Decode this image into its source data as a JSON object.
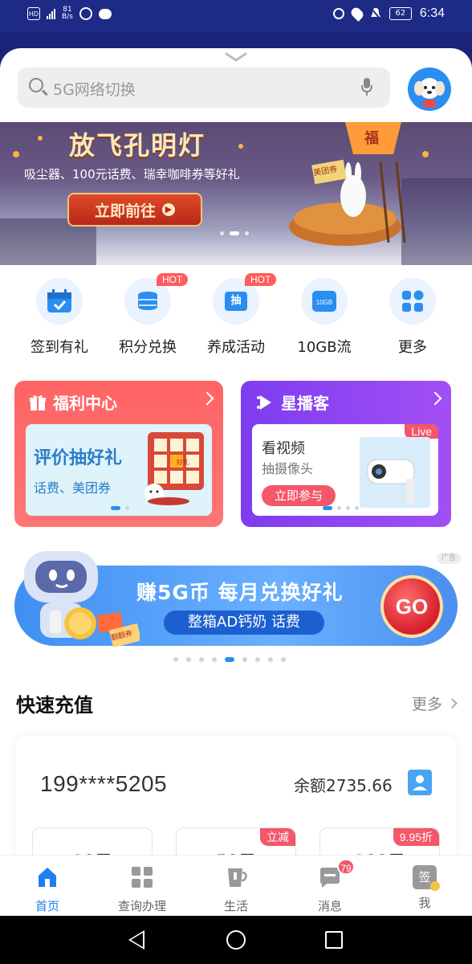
{
  "status_bar": {
    "left_chip": "HD",
    "network": "4G",
    "speed_value": "81",
    "speed_unit": "B/s",
    "battery": "62",
    "time": "6:34"
  },
  "search": {
    "placeholder": "5G网络切换"
  },
  "banner": {
    "title": "放飞孔明灯",
    "subtitle": "吸尘器、100元话费、瑞幸咖啡券等好礼",
    "cta": "立即前往",
    "coupon_text": "美团券",
    "lantern_text": "福"
  },
  "quick_icons": [
    {
      "label": "签到有礼",
      "icon": "calendar-check-icon",
      "badge": ""
    },
    {
      "label": "积分兑换",
      "icon": "coins-stack-icon",
      "badge": "HOT"
    },
    {
      "label": "养成活动",
      "icon": "lottery-icon",
      "badge": "HOT",
      "glyph": "抽"
    },
    {
      "label": "10GB流",
      "icon": "data-card-icon",
      "badge": "",
      "glyph": "10GB"
    },
    {
      "label": "更多",
      "icon": "grid-more-icon",
      "badge": ""
    }
  ],
  "cards": {
    "welfare": {
      "title": "福利中心",
      "inner_title": "评价抽好礼",
      "inner_sub": "话费、美团券",
      "prize_label": "好礼"
    },
    "star": {
      "title": "星播客",
      "line1": "看视频",
      "line2": "抽摄像头",
      "cta": "立即参与",
      "live": "Live"
    }
  },
  "ad": {
    "title": "赚5G币 每月兑换好礼",
    "subtitle": "整箱AD钙奶 话费",
    "go": "GO",
    "tag": "广告",
    "coupon": "翻翻券"
  },
  "recharge": {
    "title": "快速充值",
    "more": "更多",
    "phone": "199****5205",
    "balance": "余额2735.66",
    "amounts": [
      {
        "value": "10元",
        "badge": ""
      },
      {
        "value": "50元",
        "badge": "立减"
      },
      {
        "value": "100元",
        "badge": "9.95折"
      }
    ]
  },
  "tabs": [
    {
      "label": "首页",
      "icon": "home-icon",
      "active": true
    },
    {
      "label": "查询办理",
      "icon": "grid-icon",
      "active": false
    },
    {
      "label": "生活",
      "icon": "cup-icon",
      "active": false
    },
    {
      "label": "消息",
      "icon": "message-icon",
      "active": false,
      "badge": "79"
    },
    {
      "label": "我",
      "icon": "checkin-icon",
      "active": false,
      "glyph": "签"
    }
  ],
  "colors": {
    "accent": "#1f7ef0",
    "red": "#ff6464",
    "purple": "#8a45f2"
  }
}
